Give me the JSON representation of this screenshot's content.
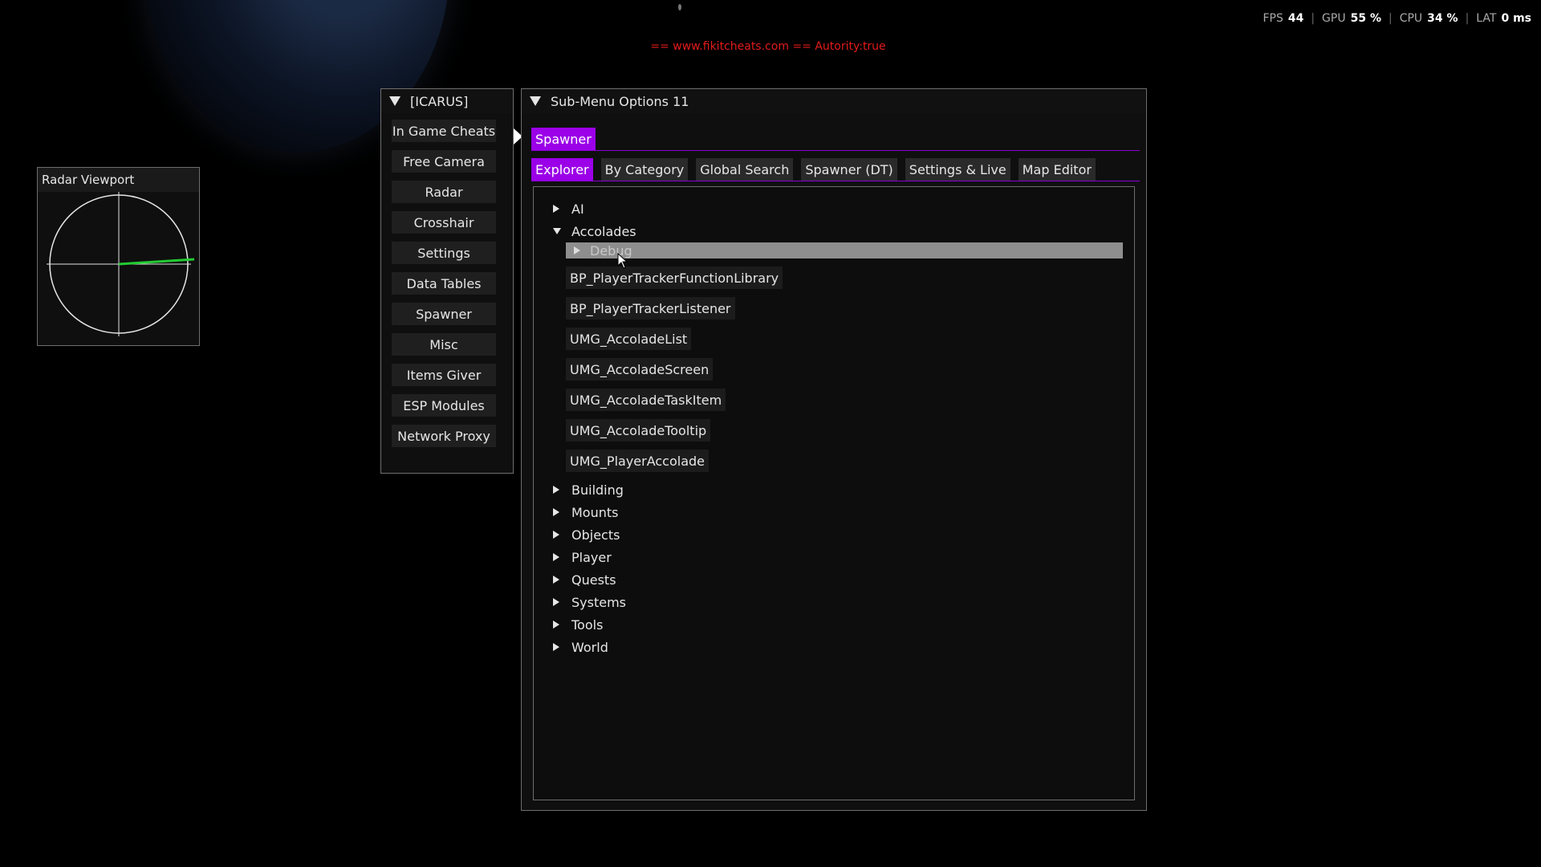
{
  "perf": {
    "fps_label": "FPS",
    "fps": "44",
    "gpu_label": "GPU",
    "gpu": "55 %",
    "cpu_label": "CPU",
    "cpu": "34 %",
    "lat_label": "LAT",
    "lat": "0 ms"
  },
  "watermark": "== www.fikitcheats.com == Autority:true",
  "radar": {
    "title": "Radar Viewport",
    "ring_color": "#e6e6e6",
    "heading_color": "#22cc33"
  },
  "icarus": {
    "title": "[ICARUS]",
    "items": [
      "In Game Cheats",
      "Free Camera",
      "Radar",
      "Crosshair",
      "Settings",
      "Data Tables",
      "Spawner",
      "Misc",
      "Items Giver",
      "ESP Modules",
      "Network Proxy"
    ]
  },
  "submenu": {
    "title": "Sub-Menu Options 11",
    "top_tabs": [
      "Spawner"
    ],
    "tabs": [
      "Explorer",
      "By Category",
      "Global Search",
      "Spawner (DT)",
      "Settings & Live",
      "Map Editor"
    ],
    "active_tab": "Explorer",
    "accent_color": "#9b00e8"
  },
  "tree": {
    "ai": "AI",
    "accolades": "Accolades",
    "debug": "Debug",
    "leaves": [
      "BP_PlayerTrackerFunctionLibrary",
      "BP_PlayerTrackerListener",
      "UMG_AccoladeList",
      "UMG_AccoladeScreen",
      "UMG_AccoladeTaskItem",
      "UMG_AccoladeTooltip",
      "UMG_PlayerAccolade"
    ],
    "folders": [
      "Building",
      "Mounts",
      "Objects",
      "Player",
      "Quests",
      "Systems",
      "Tools",
      "World"
    ]
  }
}
